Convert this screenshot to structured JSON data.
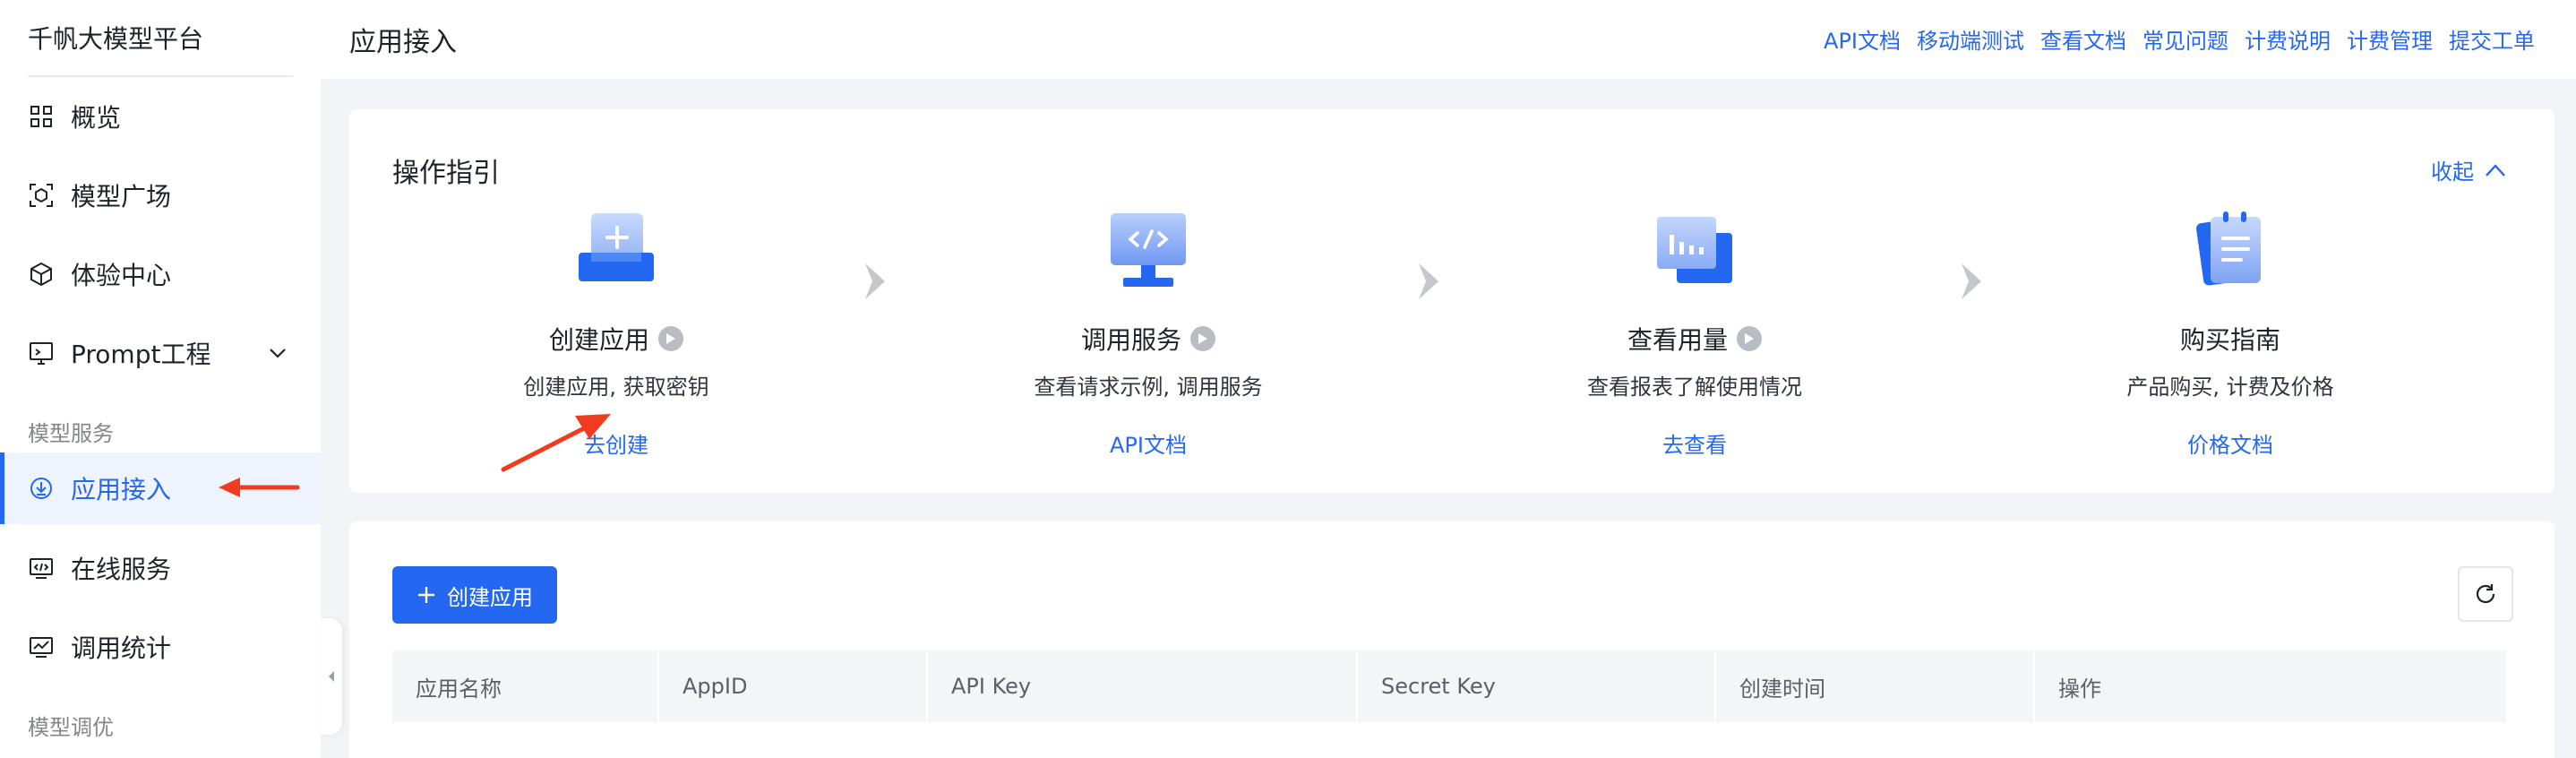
{
  "brand": "千帆大模型平台",
  "sidebar": {
    "items": [
      {
        "label": "概览",
        "icon": "grid-icon"
      },
      {
        "label": "模型广场",
        "icon": "model-square-icon"
      },
      {
        "label": "体验中心",
        "icon": "cube-icon"
      },
      {
        "label": "Prompt工程",
        "icon": "prompt-icon"
      }
    ],
    "group_model_service": "模型服务",
    "service_items": [
      {
        "label": "应用接入",
        "icon": "app-access-icon",
        "active": true
      },
      {
        "label": "在线服务",
        "icon": "online-service-icon"
      },
      {
        "label": "调用统计",
        "icon": "stats-icon"
      }
    ],
    "group_model_tuning": "模型调优"
  },
  "header": {
    "title": "应用接入",
    "links": [
      "API文档",
      "移动端测试",
      "查看文档",
      "常见问题",
      "计费说明",
      "计费管理",
      "提交工单"
    ]
  },
  "guide": {
    "title": "操作指引",
    "collapse_label": "收起",
    "steps": [
      {
        "title": "创建应用",
        "desc": "创建应用, 获取密钥",
        "link": "去创建",
        "illus": "create-app-illustration",
        "has_video": true
      },
      {
        "title": "调用服务",
        "desc": "查看请求示例, 调用服务",
        "link": "API文档",
        "illus": "call-service-illustration",
        "has_video": true
      },
      {
        "title": "查看用量",
        "desc": "查看报表了解使用情况",
        "link": "去查看",
        "illus": "usage-illustration",
        "has_video": true
      },
      {
        "title": "购买指南",
        "desc": "产品购买, 计费及价格",
        "link": "价格文档",
        "illus": "purchase-guide-illustration",
        "has_video": false
      }
    ]
  },
  "apps": {
    "create_label": "创建应用",
    "columns": [
      "应用名称",
      "AppID",
      "API Key",
      "Secret Key",
      "创建时间",
      "操作"
    ]
  },
  "colors": {
    "accent": "#2468f2",
    "annotation": "#f03c1e",
    "background": "#f3f4f7"
  }
}
